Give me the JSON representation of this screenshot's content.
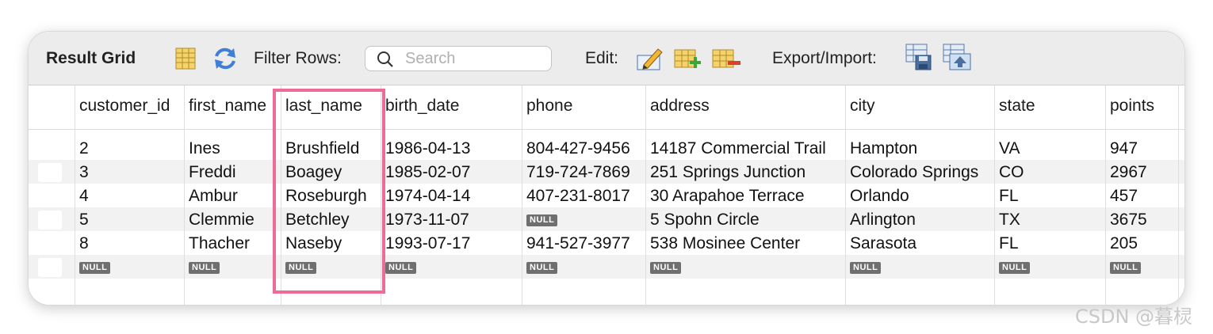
{
  "toolbar": {
    "title": "Result Grid",
    "filter_label": "Filter Rows:",
    "search_placeholder": "Search",
    "edit_label": "Edit:",
    "export_label": "Export/Import:",
    "icons": [
      "grid-toggle-icon",
      "refresh-icon",
      "search-icon",
      "edit-pencil-icon",
      "add-row-icon",
      "delete-row-icon",
      "export-icon",
      "import-icon"
    ]
  },
  "grid": {
    "columns": [
      "customer_id",
      "first_name",
      "last_name",
      "birth_date",
      "phone",
      "address",
      "city",
      "state",
      "points"
    ],
    "null_text": "NULL",
    "rows": [
      [
        "2",
        "Ines",
        "Brushfield",
        "1986-04-13",
        "804-427-9456",
        "14187 Commercial Trail",
        "Hampton",
        "VA",
        "947"
      ],
      [
        "3",
        "Freddi",
        "Boagey",
        "1985-02-07",
        "719-724-7869",
        "251 Springs Junction",
        "Colorado Springs",
        "CO",
        "2967"
      ],
      [
        "4",
        "Ambur",
        "Roseburgh",
        "1974-04-14",
        "407-231-8017",
        "30 Arapahoe Terrace",
        "Orlando",
        "FL",
        "457"
      ],
      [
        "5",
        "Clemmie",
        "Betchley",
        "1973-11-07",
        "NULL",
        "5 Spohn Circle",
        "Arlington",
        "TX",
        "3675"
      ],
      [
        "8",
        "Thacher",
        "Naseby",
        "1993-07-17",
        "941-527-3977",
        "538 Mosinee Center",
        "Sarasota",
        "FL",
        "205"
      ],
      [
        "NULL",
        "NULL",
        "NULL",
        "NULL",
        "NULL",
        "NULL",
        "NULL",
        "NULL",
        "NULL"
      ]
    ]
  },
  "accent": {
    "highlight": "#ee6b96",
    "null_badge": "#6f6f6f"
  },
  "watermark": "CSDN @暮棂"
}
